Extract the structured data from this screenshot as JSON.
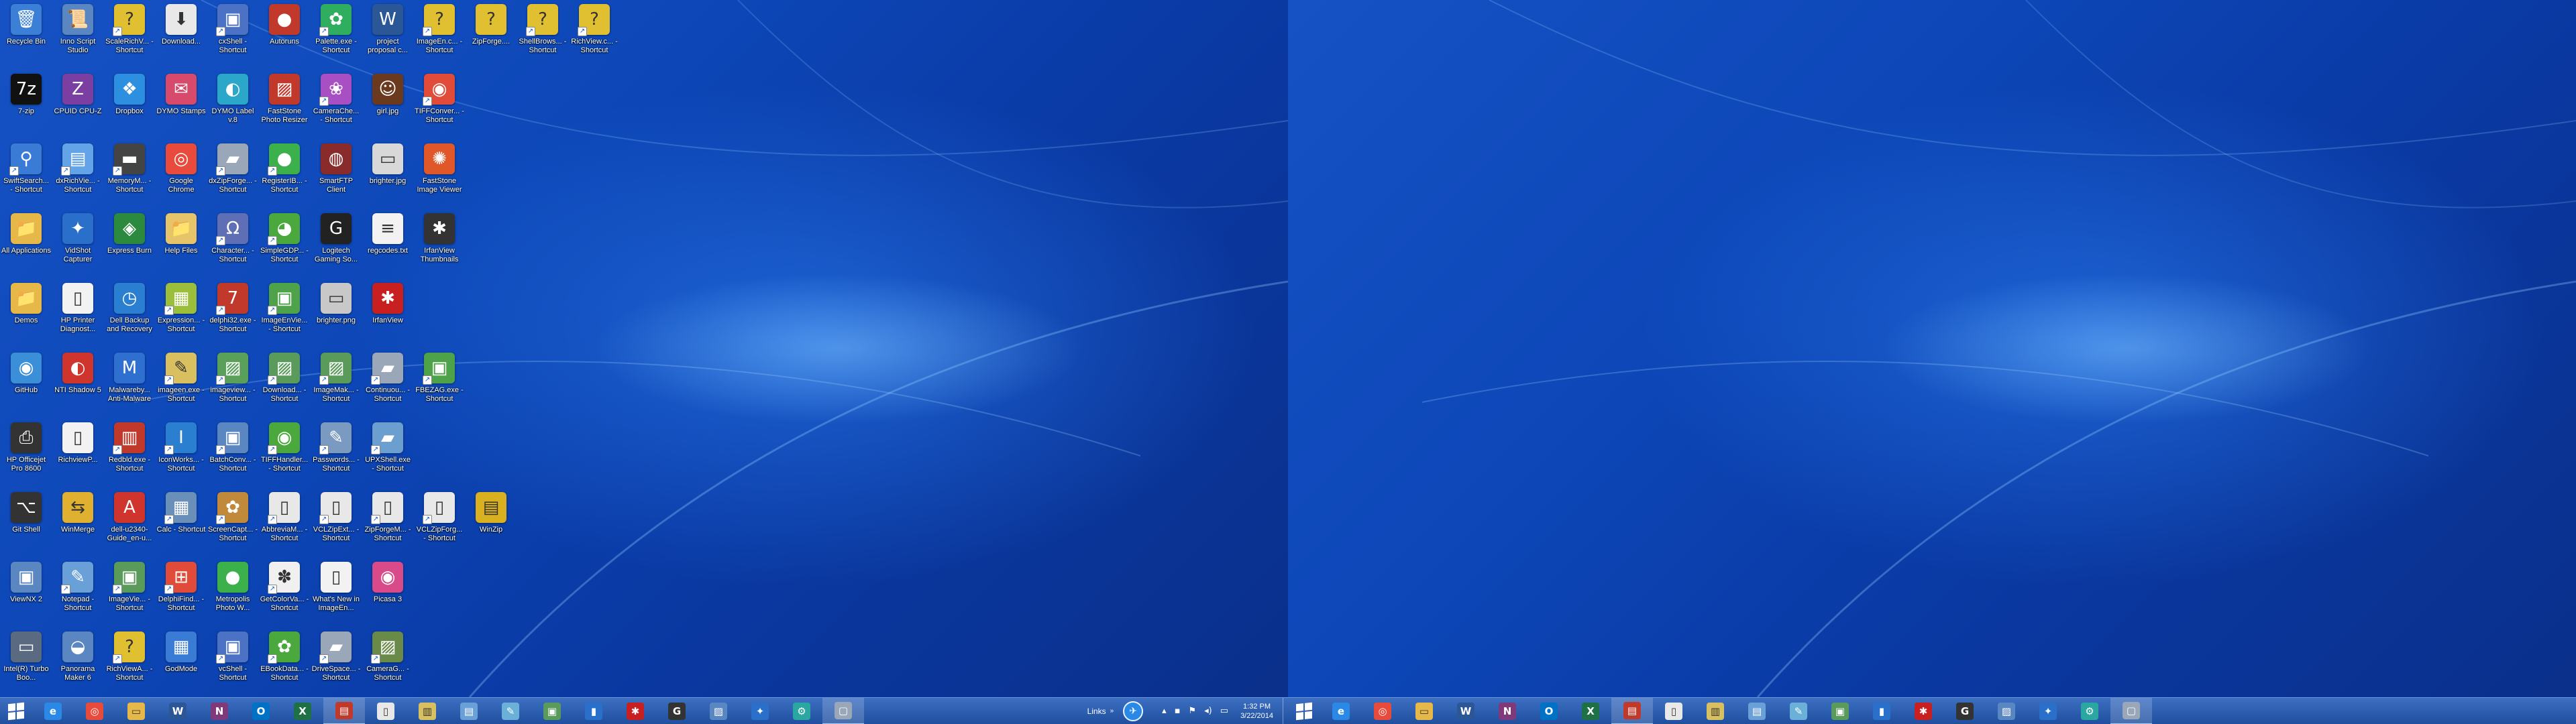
{
  "desktop_icons": [
    {
      "label": "Recycle Bin",
      "icon": "recycle-bin-icon",
      "glyph": "🗑",
      "color": "#3b7fd6",
      "shortcut": false
    },
    {
      "label": "Inno Script Studio",
      "icon": "inno-script-icon",
      "glyph": "📜",
      "color": "#5a86c2",
      "shortcut": false
    },
    {
      "label": "ScaleRichV... - Shortcut",
      "icon": "unknown-file-icon",
      "glyph": "?",
      "color": "#e0c030",
      "shortcut": true
    },
    {
      "label": "Download...",
      "icon": "downloads-folder-icon",
      "glyph": "⬇",
      "color": "#e8e8e8",
      "shortcut": false
    },
    {
      "label": "cxShell - Shortcut",
      "icon": "cxshell-icon",
      "glyph": "▣",
      "color": "#4b72c4",
      "shortcut": true
    },
    {
      "label": "Autoruns",
      "icon": "autoruns-icon",
      "glyph": "●",
      "color": "#c0392b",
      "shortcut": false
    },
    {
      "label": "Palette.exe - Shortcut",
      "icon": "palette-icon",
      "glyph": "✿",
      "color": "#2fae60",
      "shortcut": true
    },
    {
      "label": "project proposal c...",
      "icon": "word-document-icon",
      "glyph": "W",
      "color": "#2b5797",
      "shortcut": false
    },
    {
      "label": "ImageEn.c... - Shortcut",
      "icon": "unknown-file-icon",
      "glyph": "?",
      "color": "#e0c030",
      "shortcut": true
    },
    {
      "label": "ZipForge....",
      "icon": "unknown-file-icon",
      "glyph": "?",
      "color": "#e0c030",
      "shortcut": false
    },
    {
      "label": "ShellBrows... - Shortcut",
      "icon": "unknown-file-icon",
      "glyph": "?",
      "color": "#e0c030",
      "shortcut": true
    },
    {
      "label": "RichView.c... - Shortcut",
      "icon": "unknown-file-icon",
      "glyph": "?",
      "color": "#e0c030",
      "shortcut": true
    },
    {
      "label": "7-zip",
      "icon": "7zip-icon",
      "glyph": "7z",
      "color": "#111111",
      "shortcut": false
    },
    {
      "label": "CPUID CPU-Z",
      "icon": "cpuz-icon",
      "glyph": "Z",
      "color": "#7a3fa0",
      "shortcut": false
    },
    {
      "label": "Dropbox",
      "icon": "dropbox-icon",
      "glyph": "❖",
      "color": "#2d8fe0",
      "shortcut": false
    },
    {
      "label": "DYMO Stamps",
      "icon": "dymo-stamps-icon",
      "glyph": "✉",
      "color": "#d84a6b",
      "shortcut": false
    },
    {
      "label": "DYMO Label v.8",
      "icon": "dymo-label-icon",
      "glyph": "◐",
      "color": "#2aa7c9",
      "shortcut": false
    },
    {
      "label": "FastStone Photo Resizer",
      "icon": "faststone-resizer-icon",
      "glyph": "▨",
      "color": "#c0392b",
      "shortcut": false
    },
    {
      "label": "CameraChe... - Shortcut",
      "icon": "camera-icon",
      "glyph": "❀",
      "color": "#a94fc4",
      "shortcut": true
    },
    {
      "label": "girl.jpg",
      "icon": "image-file-icon",
      "glyph": "☺",
      "color": "#6b3a1e",
      "shortcut": false
    },
    {
      "label": "TIFFConver... - Shortcut",
      "icon": "tiff-converter-icon",
      "glyph": "◉",
      "color": "#e04b3a",
      "shortcut": true
    },
    {
      "label": "SwiftSearch... - Shortcut",
      "icon": "swiftsearch-icon",
      "glyph": "⚲",
      "color": "#3a7bd5",
      "shortcut": true
    },
    {
      "label": "dxRichVie... - Shortcut",
      "icon": "dxrichview-icon",
      "glyph": "▤",
      "color": "#63a4e8",
      "shortcut": true
    },
    {
      "label": "MemoryM... - Shortcut",
      "icon": "memory-icon",
      "glyph": "▬",
      "color": "#444444",
      "shortcut": true
    },
    {
      "label": "Google Chrome",
      "icon": "chrome-icon",
      "glyph": "◎",
      "color": "#e84a3c",
      "shortcut": false
    },
    {
      "label": "dxZipForge... - Shortcut",
      "icon": "zipforge-icon",
      "glyph": "▰",
      "color": "#9aa7b8",
      "shortcut": true
    },
    {
      "label": "RegisterIB... - Shortcut",
      "icon": "register-icon",
      "glyph": "●",
      "color": "#3cb04a",
      "shortcut": true
    },
    {
      "label": "SmartFTP Client",
      "icon": "smartftp-icon",
      "glyph": "◍",
      "color": "#8a2b2b",
      "shortcut": false
    },
    {
      "label": "brighter.jpg",
      "icon": "image-file-icon",
      "glyph": "▭",
      "color": "#d8d8d8",
      "shortcut": false
    },
    {
      "label": "FastStone Image Viewer",
      "icon": "faststone-viewer-icon",
      "glyph": "✺",
      "color": "#e0572a",
      "shortcut": false
    },
    {
      "label": "All Applications",
      "icon": "folder-icon",
      "glyph": "📁",
      "color": "#e6b84a",
      "shortcut": false
    },
    {
      "label": "VidShot Capturer",
      "icon": "vidshot-icon",
      "glyph": "✦",
      "color": "#2a6fc9",
      "shortcut": false
    },
    {
      "label": "Express Burn",
      "icon": "express-burn-icon",
      "glyph": "◈",
      "color": "#2b8a3e",
      "shortcut": false
    },
    {
      "label": "Help Files",
      "icon": "folder-icon",
      "glyph": "📁",
      "color": "#e6c46a",
      "shortcut": false
    },
    {
      "label": "Character... - Shortcut",
      "icon": "character-map-icon",
      "glyph": "Ω",
      "color": "#5f6fb5",
      "shortcut": true
    },
    {
      "label": "SimpleGDP... - Shortcut",
      "icon": "simplegdp-icon",
      "glyph": "◕",
      "color": "#4aa83c",
      "shortcut": true
    },
    {
      "label": "Logitech Gaming So...",
      "icon": "logitech-icon",
      "glyph": "G",
      "color": "#222222",
      "shortcut": false
    },
    {
      "label": "regcodes.txt",
      "icon": "text-file-icon",
      "glyph": "≡",
      "color": "#f2f2f2",
      "shortcut": false
    },
    {
      "label": "IrfanView Thumbnails",
      "icon": "irfanview-thumbs-icon",
      "glyph": "✱",
      "color": "#333333",
      "shortcut": false
    },
    {
      "label": "Demos",
      "icon": "folder-icon",
      "glyph": "📁",
      "color": "#e6b84a",
      "shortcut": false
    },
    {
      "label": "HP Printer Diagnost...",
      "icon": "document-icon",
      "glyph": "▯",
      "color": "#f2f2f2",
      "shortcut": false
    },
    {
      "label": "Dell Backup and Recovery",
      "icon": "dell-backup-icon",
      "glyph": "◷",
      "color": "#2a7fd0",
      "shortcut": false
    },
    {
      "label": "Expression... - Shortcut",
      "icon": "expression-icon",
      "glyph": "▦",
      "color": "#9bbf3a",
      "shortcut": true
    },
    {
      "label": "delphi32.exe - Shortcut",
      "icon": "delphi-icon",
      "glyph": "7",
      "color": "#c0392b",
      "shortcut": true
    },
    {
      "label": "ImageEnVie... - Shortcut",
      "icon": "imageen-icon",
      "glyph": "▣",
      "color": "#4ea24a",
      "shortcut": true
    },
    {
      "label": "brighter.png",
      "icon": "image-file-icon",
      "glyph": "▭",
      "color": "#c8c8c8",
      "shortcut": false
    },
    {
      "label": "IrfanView",
      "icon": "irfanview-icon",
      "glyph": "✱",
      "color": "#c82020",
      "shortcut": false
    },
    {
      "label": "GitHub",
      "icon": "github-icon",
      "glyph": "◉",
      "color": "#3a8fd8",
      "shortcut": false
    },
    {
      "label": "NTI Shadow 5",
      "icon": "nti-shadow-icon",
      "glyph": "◐",
      "color": "#d0352d",
      "shortcut": false
    },
    {
      "label": "Malwareby... Anti-Malware",
      "icon": "malwarebytes-icon",
      "glyph": "M",
      "color": "#2e6fd0",
      "shortcut": false
    },
    {
      "label": "imageen.exe - Shortcut",
      "icon": "imageen-exe-icon",
      "glyph": "✎",
      "color": "#d8c060",
      "shortcut": true
    },
    {
      "label": "imageview... - Shortcut",
      "icon": "imageview-icon",
      "glyph": "▨",
      "color": "#5aa05a",
      "shortcut": true
    },
    {
      "label": "Download... - Shortcut",
      "icon": "download-shortcut-icon",
      "glyph": "▨",
      "color": "#5a9a5a",
      "shortcut": true
    },
    {
      "label": "ImageMak... - Shortcut",
      "icon": "imagemaker-icon",
      "glyph": "▨",
      "color": "#5a9a5a",
      "shortcut": true
    },
    {
      "label": "Continuou... - Shortcut",
      "icon": "continuous-icon",
      "glyph": "▰",
      "color": "#9aa7b8",
      "shortcut": true
    },
    {
      "label": "FBEZAG.exe - Shortcut",
      "icon": "fbezag-icon",
      "glyph": "▣",
      "color": "#4ea24a",
      "shortcut": true
    },
    {
      "label": "HP Officejet Pro 8600",
      "icon": "printer-icon",
      "glyph": "⎙",
      "color": "#333333",
      "shortcut": false
    },
    {
      "label": "RichviewP...",
      "icon": "document-icon",
      "glyph": "▯",
      "color": "#f2f2f2",
      "shortcut": false
    },
    {
      "label": "Redbld.exe - Shortcut",
      "icon": "redbld-icon",
      "glyph": "▥",
      "color": "#c0392b",
      "shortcut": true
    },
    {
      "label": "IconWorks... - Shortcut",
      "icon": "iconworks-icon",
      "glyph": "I",
      "color": "#2a7fd0",
      "shortcut": true
    },
    {
      "label": "BatchConv... - Shortcut",
      "icon": "batchconv-icon",
      "glyph": "▣",
      "color": "#5a86c2",
      "shortcut": true
    },
    {
      "label": "TIFFHandler... - Shortcut",
      "icon": "tiffhandler-icon",
      "glyph": "◉",
      "color": "#4aa83c",
      "shortcut": true
    },
    {
      "label": "Passwords... - Shortcut",
      "icon": "passwords-icon",
      "glyph": "✎",
      "color": "#7a9ac2",
      "shortcut": true
    },
    {
      "label": "UPXShell.exe - Shortcut",
      "icon": "upxshell-icon",
      "glyph": "▰",
      "color": "#6a9fd0",
      "shortcut": true
    },
    {
      "label": "Git Shell",
      "icon": "git-shell-icon",
      "glyph": "⌥",
      "color": "#333333",
      "shortcut": false
    },
    {
      "label": "WinMerge",
      "icon": "winmerge-icon",
      "glyph": "⇆",
      "color": "#e0b030",
      "shortcut": false
    },
    {
      "label": "dell-u2340-Guide_en-u...",
      "icon": "pdf-icon",
      "glyph": "A",
      "color": "#d0352d",
      "shortcut": false
    },
    {
      "label": "Calc - Shortcut",
      "icon": "calculator-icon",
      "glyph": "▦",
      "color": "#6a8fb8",
      "shortcut": true
    },
    {
      "label": "ScreenCapt... - Shortcut",
      "icon": "screencapture-icon",
      "glyph": "✿",
      "color": "#c08a3a",
      "shortcut": true
    },
    {
      "label": "AbbreviaM... - Shortcut",
      "icon": "abbrevia-icon",
      "glyph": "▯",
      "color": "#e8e8e8",
      "shortcut": true
    },
    {
      "label": "VCLZipExt... - Shortcut",
      "icon": "vclzip-icon",
      "glyph": "▯",
      "color": "#e8e8e8",
      "shortcut": true
    },
    {
      "label": "ZipForgeM... - Shortcut",
      "icon": "zipforge-m-icon",
      "glyph": "▯",
      "color": "#e8e8e8",
      "shortcut": true
    },
    {
      "label": "VCLZipForg... - Shortcut",
      "icon": "vclzipforge-icon",
      "glyph": "▯",
      "color": "#e8e8e8",
      "shortcut": true
    },
    {
      "label": "WinZip",
      "icon": "winzip-icon",
      "glyph": "▤",
      "color": "#d8b020",
      "shortcut": false
    },
    {
      "label": "ViewNX 2",
      "icon": "viewnx-icon",
      "glyph": "▣",
      "color": "#5a86c2",
      "shortcut": false
    },
    {
      "label": "Notepad - Shortcut",
      "icon": "notepad-icon",
      "glyph": "✎",
      "color": "#6aa0d8",
      "shortcut": true
    },
    {
      "label": "ImageVie... - Shortcut",
      "icon": "imageviewer-icon",
      "glyph": "▣",
      "color": "#5a9a5a",
      "shortcut": true
    },
    {
      "label": "DelphiFind... - Shortcut",
      "icon": "delphifind-icon",
      "glyph": "⊞",
      "color": "#e04b3a",
      "shortcut": true
    },
    {
      "label": "Metropolis Photo W...",
      "icon": "metropolis-icon",
      "glyph": "●",
      "color": "#3cb04a",
      "shortcut": false
    },
    {
      "label": "GetColorVa... - Shortcut",
      "icon": "getcolor-icon",
      "glyph": "✽",
      "color": "#f0f0f0",
      "shortcut": true
    },
    {
      "label": "What's New in ImageEn...",
      "icon": "document-icon",
      "glyph": "▯",
      "color": "#f2f2f2",
      "shortcut": false
    },
    {
      "label": "Picasa 3",
      "icon": "picasa-icon",
      "glyph": "◉",
      "color": "#d84a8a",
      "shortcut": false
    },
    {
      "label": "Intel(R) Turbo Boo...",
      "icon": "intel-turbo-icon",
      "glyph": "▭",
      "color": "#5a6a80",
      "shortcut": false
    },
    {
      "label": "Panorama Maker 6",
      "icon": "panorama-icon",
      "glyph": "◒",
      "color": "#5a86c2",
      "shortcut": false
    },
    {
      "label": "RichViewA... - Shortcut",
      "icon": "unknown-file-icon",
      "glyph": "?",
      "color": "#e0c030",
      "shortcut": true
    },
    {
      "label": "GodMode",
      "icon": "godmode-icon",
      "glyph": "▦",
      "color": "#3a7bd5",
      "shortcut": false
    },
    {
      "label": "vcShell - Shortcut",
      "icon": "vcshell-icon",
      "glyph": "▣",
      "color": "#4b72c4",
      "shortcut": true
    },
    {
      "label": "EBookData... - Shortcut",
      "icon": "ebookdata-icon",
      "glyph": "✿",
      "color": "#4aa83c",
      "shortcut": true
    },
    {
      "label": "DriveSpace... - Shortcut",
      "icon": "drivespace-icon",
      "glyph": "▰",
      "color": "#9aa7b8",
      "shortcut": true
    },
    {
      "label": "CameraG... - Shortcut",
      "icon": "camerag-icon",
      "glyph": "▨",
      "color": "#6a8a4a",
      "shortcut": true
    }
  ],
  "taskbar": {
    "pinned": [
      {
        "name": "internet-explorer",
        "glyph": "e",
        "color": "#2a89e6",
        "active": false
      },
      {
        "name": "chrome",
        "glyph": "◎",
        "color": "#e84a3c",
        "active": false
      },
      {
        "name": "file-explorer",
        "glyph": "▭",
        "color": "#e6b84a",
        "active": false
      },
      {
        "name": "word",
        "glyph": "W",
        "color": "#2b5797",
        "active": false
      },
      {
        "name": "onenote",
        "glyph": "N",
        "color": "#80397b",
        "active": false
      },
      {
        "name": "outlook",
        "glyph": "O",
        "color": "#0072c6",
        "active": false
      },
      {
        "name": "excel",
        "glyph": "X",
        "color": "#1e7145",
        "active": false
      },
      {
        "name": "pdf-reader",
        "glyph": "▤",
        "color": "#c0392b",
        "active": true
      },
      {
        "name": "document",
        "glyph": "▯",
        "color": "#e8e8e8",
        "active": false
      },
      {
        "name": "notes",
        "glyph": "▥",
        "color": "#d8c060",
        "active": false
      },
      {
        "name": "text-editor",
        "glyph": "▤",
        "color": "#6aa0d8",
        "active": false
      },
      {
        "name": "tool",
        "glyph": "✎",
        "color": "#6ab0d8",
        "active": false
      },
      {
        "name": "image-viewer",
        "glyph": "▣",
        "color": "#5a9a5a",
        "active": false
      },
      {
        "name": "bookmark",
        "glyph": "▮",
        "color": "#2a6fc9",
        "active": false
      },
      {
        "name": "irfanview",
        "glyph": "✱",
        "color": "#c82020",
        "active": false
      },
      {
        "name": "logitech",
        "glyph": "G",
        "color": "#333333",
        "active": false
      },
      {
        "name": "photo",
        "glyph": "▨",
        "color": "#5a86c2",
        "active": false
      },
      {
        "name": "vidshot",
        "glyph": "✦",
        "color": "#2a6fc9",
        "active": false
      },
      {
        "name": "settings",
        "glyph": "⚙",
        "color": "#2aa7a0",
        "active": false
      },
      {
        "name": "window",
        "glyph": "▢",
        "color": "#9aa7b8",
        "active": true
      }
    ],
    "tray": {
      "links_label": "Links",
      "links_chevron": "»",
      "time": "1:32 PM",
      "date": "3/22/2014",
      "icons": [
        {
          "name": "tray-overflow-icon",
          "glyph": "▴"
        },
        {
          "name": "network-icon",
          "glyph": "▪"
        },
        {
          "name": "flag-icon",
          "glyph": "⚑"
        },
        {
          "name": "volume-icon",
          "glyph": "◂)"
        },
        {
          "name": "keyboard-icon",
          "glyph": "▭"
        }
      ]
    }
  },
  "monitor2_taskbar": {
    "pinned": [
      {
        "name": "internet-explorer",
        "glyph": "e",
        "color": "#2a89e6",
        "active": false
      },
      {
        "name": "chrome",
        "glyph": "◎",
        "color": "#e84a3c",
        "active": false
      },
      {
        "name": "file-explorer",
        "glyph": "▭",
        "color": "#e6b84a",
        "active": false
      },
      {
        "name": "word",
        "glyph": "W",
        "color": "#2b5797",
        "active": false
      },
      {
        "name": "onenote",
        "glyph": "N",
        "color": "#80397b",
        "active": false
      },
      {
        "name": "outlook",
        "glyph": "O",
        "color": "#0072c6",
        "active": false
      },
      {
        "name": "excel",
        "glyph": "X",
        "color": "#1e7145",
        "active": false
      },
      {
        "name": "pdf-reader",
        "glyph": "▤",
        "color": "#c0392b",
        "active": true
      },
      {
        "name": "document",
        "glyph": "▯",
        "color": "#e8e8e8",
        "active": false
      },
      {
        "name": "notes",
        "glyph": "▥",
        "color": "#d8c060",
        "active": false
      },
      {
        "name": "text-editor",
        "glyph": "▤",
        "color": "#6aa0d8",
        "active": false
      },
      {
        "name": "tool",
        "glyph": "✎",
        "color": "#6ab0d8",
        "active": false
      },
      {
        "name": "image-viewer",
        "glyph": "▣",
        "color": "#5a9a5a",
        "active": false
      },
      {
        "name": "bookmark",
        "glyph": "▮",
        "color": "#2a6fc9",
        "active": false
      },
      {
        "name": "irfanview",
        "glyph": "✱",
        "color": "#c82020",
        "active": false
      },
      {
        "name": "logitech",
        "glyph": "G",
        "color": "#333333",
        "active": false
      },
      {
        "name": "photo",
        "glyph": "▨",
        "color": "#5a86c2",
        "active": false
      },
      {
        "name": "vidshot",
        "glyph": "✦",
        "color": "#2a6fc9",
        "active": false
      },
      {
        "name": "settings",
        "glyph": "⚙",
        "color": "#2aa7a0",
        "active": false
      },
      {
        "name": "window",
        "glyph": "▢",
        "color": "#9aa7b8",
        "active": true
      }
    ]
  }
}
